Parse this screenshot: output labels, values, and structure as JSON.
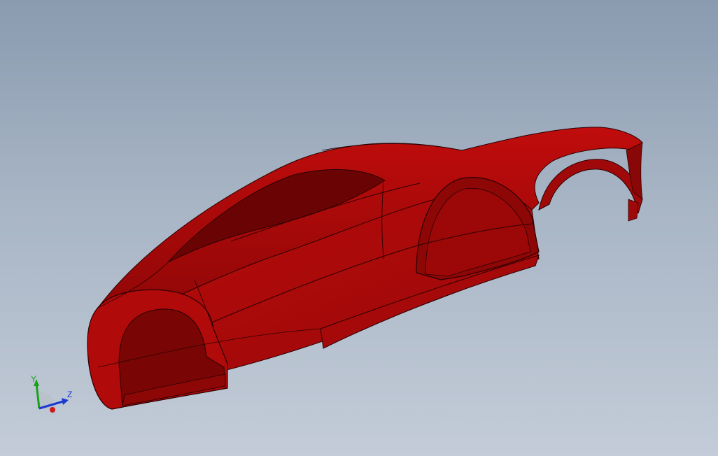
{
  "viewport": {
    "background_top": "#8a9bb0",
    "background_bottom": "#c3ccd8"
  },
  "model": {
    "body_color": "#b00a0a",
    "body_dark": "#7a0505",
    "body_mid": "#960808",
    "edge_color": "#1a0000"
  },
  "triad": {
    "y_label": "Y",
    "z_label": "Z",
    "y_color": "#1aa01a",
    "z_color": "#1a3ad0",
    "x_color": "#d01a1a"
  }
}
